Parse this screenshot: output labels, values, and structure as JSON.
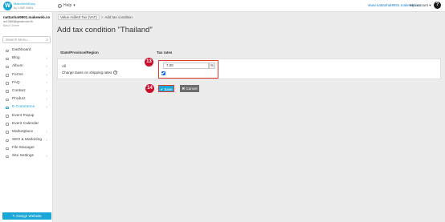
{
  "topbar": {
    "logo_letter": "W",
    "brand_name": "MakeWebEasy",
    "brand_sub": "by LINE MAN",
    "help_label": "Help",
    "site_url": "www.nattanhat9901.makeweb.co",
    "account_label": "My account",
    "help_icon": "?"
  },
  "sidebar": {
    "user_name": "nattanhat9901.makeweb.co",
    "user_email": "dz13460@gmail.com.th",
    "user_plan": "Basic Owner",
    "search_placeholder": "Search Menu...",
    "items": [
      {
        "label": "Dashboard",
        "icon": "dashboard-icon",
        "has_sub": false,
        "active": false
      },
      {
        "label": "Blog",
        "icon": "blog-icon",
        "has_sub": true,
        "active": false
      },
      {
        "label": "Album",
        "icon": "album-icon",
        "has_sub": true,
        "active": false
      },
      {
        "label": "Forms",
        "icon": "forms-icon",
        "has_sub": true,
        "active": false
      },
      {
        "label": "FAQ",
        "icon": "faq-icon",
        "has_sub": true,
        "active": false
      },
      {
        "label": "Contact",
        "icon": "contact-icon",
        "has_sub": true,
        "active": false
      },
      {
        "label": "Product",
        "icon": "product-icon",
        "has_sub": true,
        "active": false
      },
      {
        "label": "E-Commerce",
        "icon": "cart-icon",
        "has_sub": true,
        "active": true
      },
      {
        "label": "Event Popup",
        "icon": "popup-icon",
        "has_sub": false,
        "active": false
      },
      {
        "label": "Event Calendar",
        "icon": "calendar-icon",
        "has_sub": false,
        "active": false
      },
      {
        "label": "Marketplace",
        "icon": "marketplace-icon",
        "has_sub": true,
        "active": false
      },
      {
        "label": "SEO & Marketing",
        "icon": "seo-icon",
        "has_sub": true,
        "active": false
      },
      {
        "label": "File Manager",
        "icon": "folder-icon",
        "has_sub": false,
        "active": false
      },
      {
        "label": "Site Settings",
        "icon": "gear-icon",
        "has_sub": true,
        "active": false
      }
    ],
    "design_button": "Design Website"
  },
  "main": {
    "breadcrumb": {
      "parent": "Value Added Tax (VAT)",
      "separator": ">",
      "current": "Add tax condition"
    },
    "title": "Add tax condition \"Thailand\"",
    "headers": {
      "state": "State/Province/Region",
      "rates": "Tax rates"
    },
    "row_all": "All",
    "shipping_label": "Charge taxes on shipping rates",
    "rate_value": "7.00",
    "rate_unit": "%",
    "shipping_checked": true,
    "save_button": "Save",
    "cancel_button": "Cancel",
    "step_badges": {
      "rate": "13",
      "save": "14"
    }
  },
  "colors": {
    "accent": "#1aa7d8",
    "badge": "#c8102e",
    "highlight": "#e03a2f",
    "cancel": "#6d6d6d"
  }
}
